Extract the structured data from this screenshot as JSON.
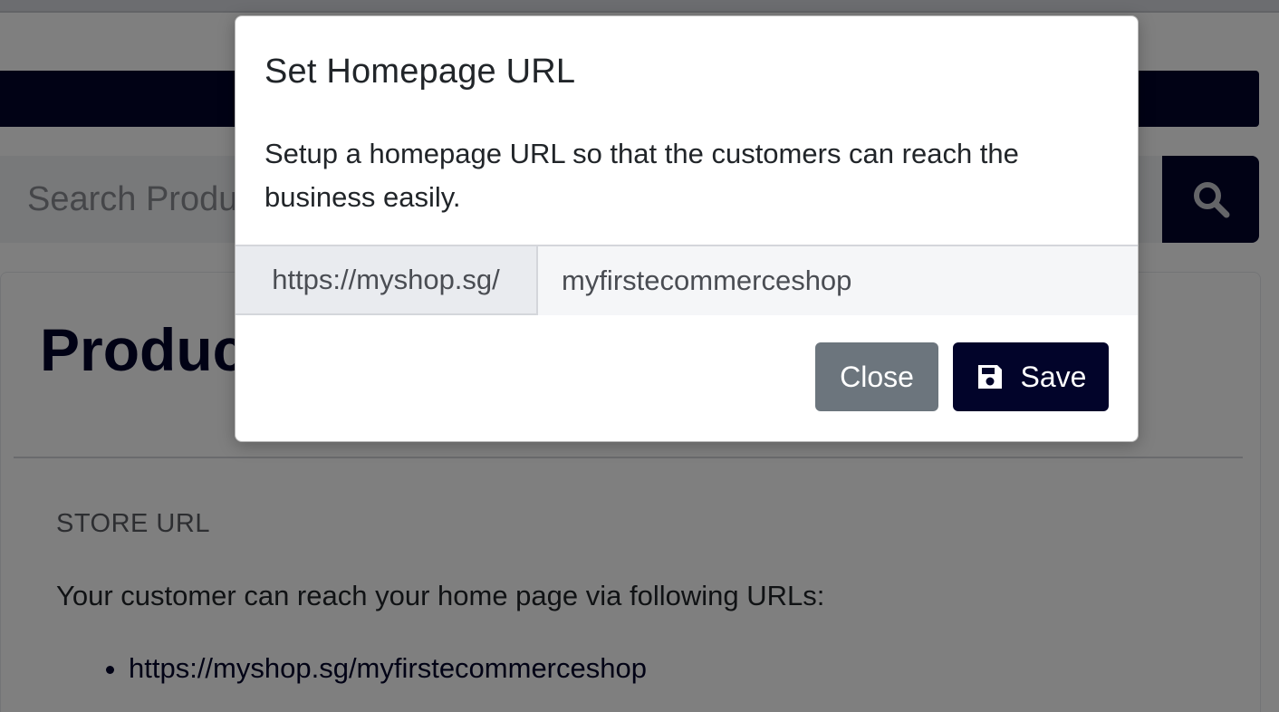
{
  "background": {
    "search": {
      "placeholder": "Search Products"
    },
    "card": {
      "title": "Products",
      "store_url_label": "STORE URL",
      "store_url_text": "Your customer can reach your home page via following URLs:",
      "urls": [
        "https://myshop.sg/myfirstecommerceshop"
      ]
    }
  },
  "modal": {
    "title": "Set Homepage URL",
    "body": "Setup a homepage URL so that the customers can reach the business easily.",
    "url_prefix": "https://myshop.sg/",
    "url_value": "myfirstecommerceshop",
    "close_label": "Close",
    "save_label": "Save",
    "save_icon": "floppy-disk-icon"
  },
  "colors": {
    "brand": "#02042a",
    "secondary_button": "#6c757d"
  }
}
